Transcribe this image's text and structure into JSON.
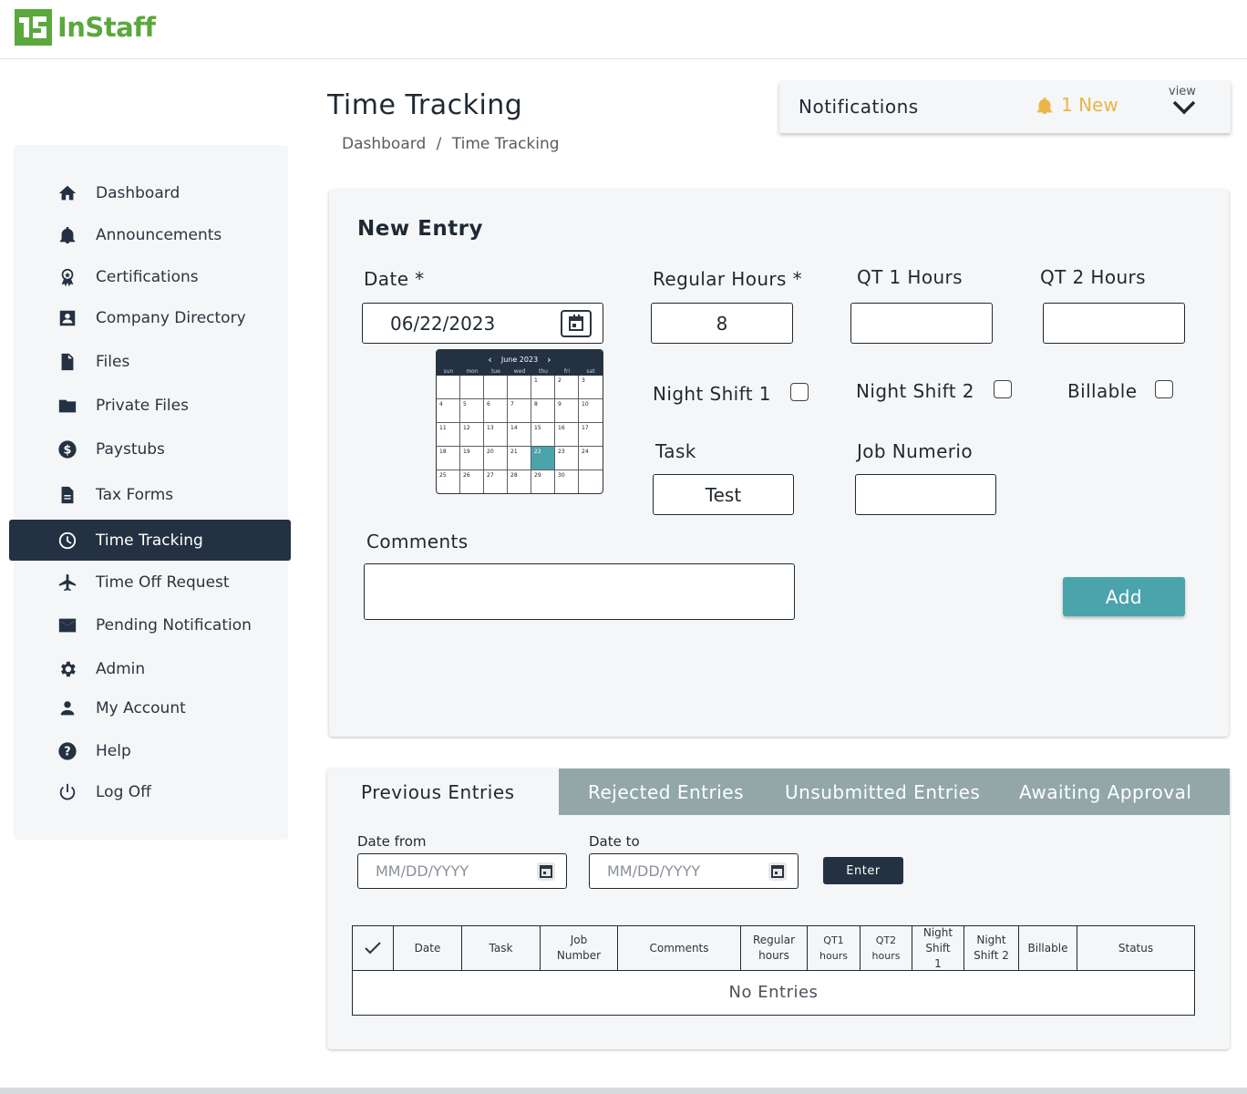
{
  "brand": {
    "name": "InStaff",
    "color": "#5aa83c"
  },
  "sidebar": {
    "items": [
      {
        "label": "Dashboard",
        "icon": "home-icon"
      },
      {
        "label": "Announcements",
        "icon": "bell-icon"
      },
      {
        "label": "Certifications",
        "icon": "award-icon"
      },
      {
        "label": "Company Directory",
        "icon": "contact-card-icon"
      },
      {
        "label": "Files",
        "icon": "file-icon"
      },
      {
        "label": "Private Files",
        "icon": "folder-icon"
      },
      {
        "label": "Paystubs",
        "icon": "dollar-icon"
      },
      {
        "label": "Tax Forms",
        "icon": "document-icon"
      },
      {
        "label": "Time Tracking",
        "icon": "clock-icon",
        "active": true
      },
      {
        "label": "Time Off Request",
        "icon": "airplane-icon"
      },
      {
        "label": "Pending Notification",
        "icon": "mail-icon"
      },
      {
        "label": "Admin",
        "icon": "gear-icon"
      },
      {
        "label": "My Account",
        "icon": "person-icon"
      },
      {
        "label": "Help",
        "icon": "help-icon"
      },
      {
        "label": "Log Off",
        "icon": "power-icon"
      }
    ]
  },
  "header": {
    "title": "Time Tracking",
    "breadcrumb": [
      "Dashboard",
      "/",
      "Time Tracking"
    ]
  },
  "notifications": {
    "title": "Notifications",
    "count_label": "1 New",
    "view_label": "view",
    "bell_color": "#e8b64a"
  },
  "new_entry": {
    "title": "New Entry",
    "date_label": "Date *",
    "date_value": "06/22/2023",
    "regular_hours_label": "Regular Hours *",
    "regular_hours_value": "8",
    "qt1_label": "QT 1 Hours",
    "qt1_value": "",
    "qt2_label": "QT 2 Hours",
    "qt2_value": "",
    "night_shift_1_label": "Night Shift  1",
    "night_shift_2_label": "Night Shift 2",
    "billable_label": "Billable",
    "task_label": "Task",
    "task_value": "Test",
    "job_label": "Job Numerio",
    "job_value": "",
    "comments_label": "Comments",
    "comments_value": "",
    "add_label": "Add",
    "accent_color": "#4ba3ac"
  },
  "calendar": {
    "month_label": "June 2023",
    "weekdays": [
      "sun",
      "mon",
      "tue",
      "wed",
      "thu",
      "fri",
      "sat"
    ],
    "leading_blanks": 4,
    "days_in_month": 30,
    "selected_day": 22
  },
  "previous": {
    "tabs": [
      "Previous Entries",
      "Rejected Entries",
      "Unsubmitted Entries",
      "Awaiting Approval"
    ],
    "date_from_label": "Date from",
    "date_to_label": "Date to",
    "date_placeholder": "MM/DD/YYYY",
    "enter_label": "Enter",
    "columns": [
      "Date",
      "Task",
      "Job Number",
      "Comments",
      "Regular hours",
      "QT1 hours",
      "QT2 hours",
      "Night Shift 1",
      "Night Shift 2",
      "Billable",
      "Status"
    ],
    "empty_text": "No Entries"
  }
}
